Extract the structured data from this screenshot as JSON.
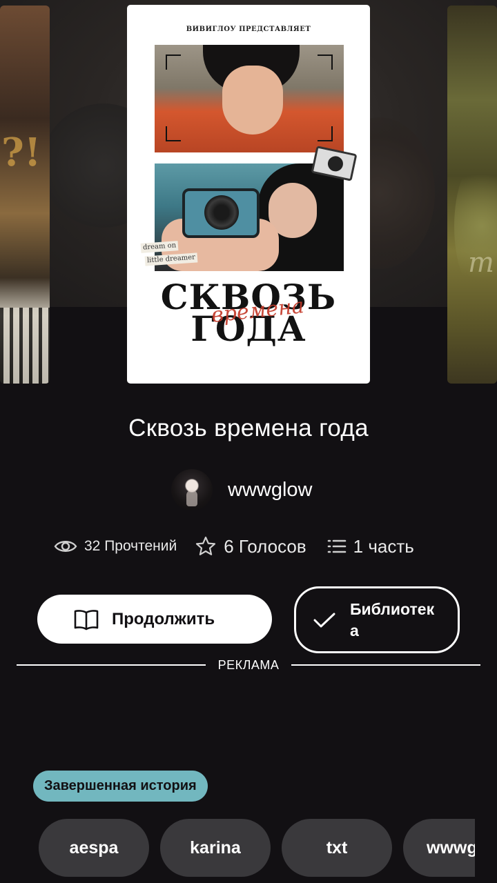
{
  "cover": {
    "presenter": "ВИВИГЛОУ ПРЕДСТАВЛЯЕТ",
    "sticker_line1": "dream on",
    "sticker_line2": "little dreamer",
    "title_line1": "СКВОЗЬ",
    "title_script": "времена",
    "title_line2": "ГОДА"
  },
  "story": {
    "title": "Сквозь времена года",
    "author": "wwwglow"
  },
  "stats": {
    "reads": "32 Прочтений",
    "votes": "6 Голосов",
    "parts": "1 часть"
  },
  "actions": {
    "continue_label": "Продолжить",
    "library_label": "Библиотека"
  },
  "ad_label": "РЕКЛАМА",
  "status_badge": "Завершенная история",
  "tags": [
    "aespa",
    "karina",
    "txt",
    "wwwglow"
  ],
  "colors": {
    "background": "#121013",
    "badge": "#72b7bf",
    "tag_bg": "#3a393c"
  },
  "icons": [
    "eye-icon",
    "star-icon",
    "list-icon",
    "book-icon",
    "check-icon"
  ]
}
